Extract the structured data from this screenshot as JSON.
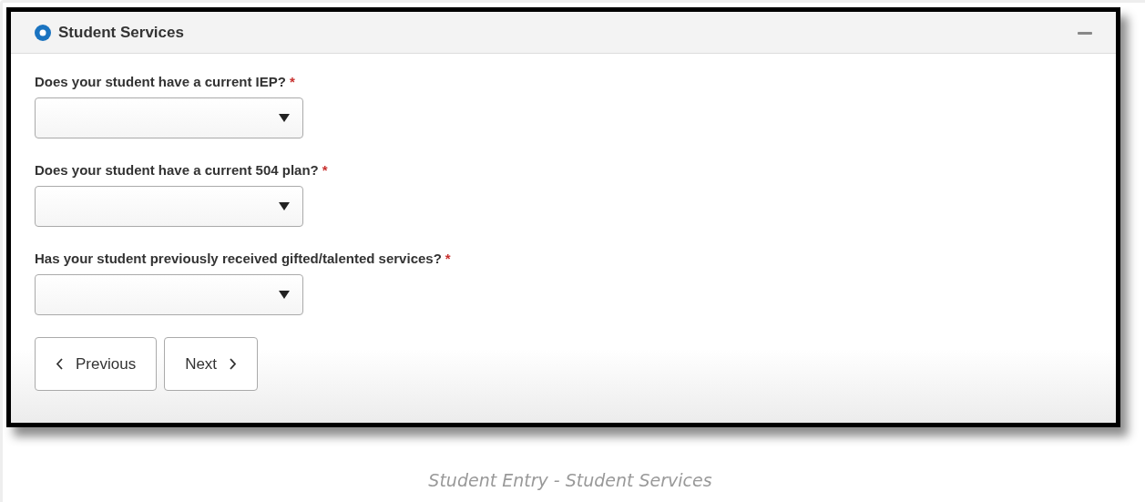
{
  "section": {
    "title": "Student Services",
    "expanded": true,
    "questions": [
      {
        "label": "Does your student have a current IEP?",
        "required_mark": "*"
      },
      {
        "label": "Does your student have a current 504 plan?",
        "required_mark": "*"
      },
      {
        "label": "Has your student previously received gifted/talented services?",
        "required_mark": "*"
      }
    ],
    "buttons": [
      {
        "label": "Previous",
        "kind": "back"
      },
      {
        "label": "Next",
        "kind": "forward"
      }
    ]
  },
  "caption": "Student Entry - Student Services"
}
